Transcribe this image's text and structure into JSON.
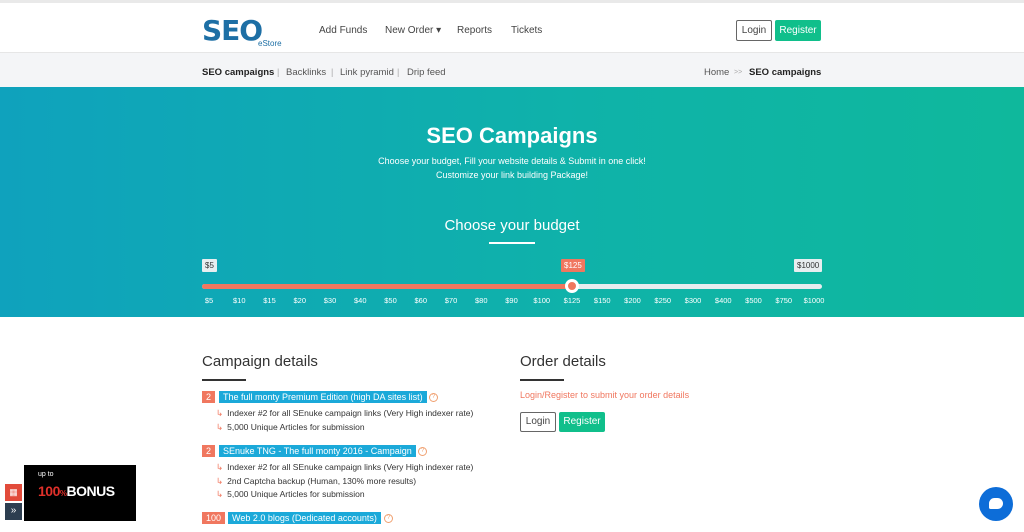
{
  "logo": {
    "text": "SEO",
    "sub": "eStore"
  },
  "nav": {
    "add_funds": "Add Funds",
    "new_order": "New Order ▾",
    "reports": "Reports",
    "tickets": "Tickets"
  },
  "auth": {
    "login": "Login",
    "register": "Register"
  },
  "subnav": {
    "items": [
      "SEO campaigns",
      "Backlinks",
      "Link pyramid",
      "Drip feed"
    ],
    "sep": "|",
    "breadcrumb": {
      "home": "Home",
      "sep": ">>",
      "current": "SEO campaigns"
    }
  },
  "hero": {
    "title": "SEO Campaigns",
    "line1": "Choose your budget, Fill your website details & Submit in one click!",
    "line2": "Customize your link building Package!",
    "budget_title": "Choose your budget"
  },
  "slider": {
    "min_label": "$5",
    "max_label": "$1000",
    "current_label": "$125",
    "current_index": 12,
    "ticks": [
      "$5",
      "$10",
      "$15",
      "$20",
      "$30",
      "$40",
      "$50",
      "$60",
      "$70",
      "$80",
      "$90",
      "$100",
      "$125",
      "$150",
      "$200",
      "$250",
      "$300",
      "$400",
      "$500",
      "$750",
      "$1000"
    ],
    "colors": {
      "fill": "#f0775f",
      "track": "#e8ecef"
    }
  },
  "campaign": {
    "title": "Campaign details",
    "items": [
      {
        "qty": "2",
        "name": "The full monty Premium Edition (high DA sites list)",
        "subs": [
          "Indexer #2 for all SEnuke campaign links (Very High indexer rate)",
          "5,000 Unique Articles for submission"
        ]
      },
      {
        "qty": "2",
        "name": "SEnuke TNG - The full monty 2016 - Campaign",
        "subs": [
          "Indexer #2 for all SEnuke campaign links (Very High indexer rate)",
          "2nd Captcha backup (Human, 130% more results)",
          "5,000 Unique Articles for submission"
        ]
      },
      {
        "qty": "100",
        "name": "Web 2.0 blogs (Dedicated accounts)",
        "subs": []
      }
    ],
    "sub_arrow": "↳",
    "help_icon": "?"
  },
  "order": {
    "title": "Order details",
    "link": "Login/Register to submit your order details",
    "login": "Login",
    "register": "Register"
  },
  "bonus": {
    "upto": "up to",
    "amount": "100",
    "suffix": "%",
    "word": "BONUS",
    "gift_icon": "gift-icon",
    "expand_icon": "»"
  },
  "chat": {
    "icon": "chat-bubble-icon"
  }
}
